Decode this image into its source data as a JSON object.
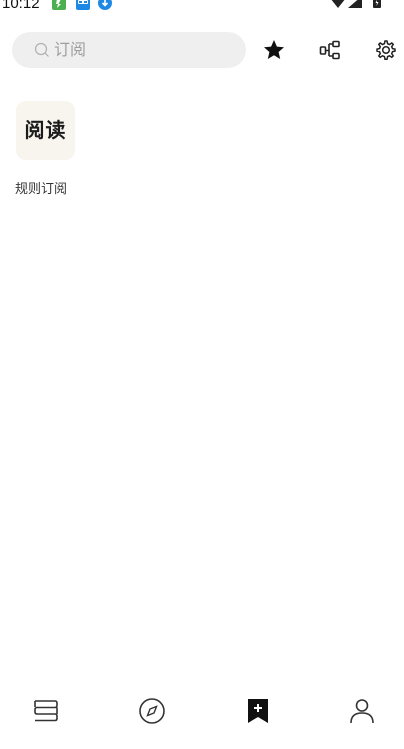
{
  "status_bar": {
    "time": "10:12"
  },
  "search": {
    "placeholder": "订阅"
  },
  "toolbar": {
    "favorites_icon": "star-icon",
    "group_icon": "group-icon",
    "settings_icon": "gear-icon"
  },
  "rule_sources": [
    {
      "tile_text": "阅读",
      "label": "规则订阅"
    }
  ],
  "bottom_nav": {
    "items": [
      {
        "icon": "bookshelf-icon",
        "active": false
      },
      {
        "icon": "compass-icon",
        "active": false
      },
      {
        "icon": "bookmark-add-icon",
        "active": true
      },
      {
        "icon": "person-icon",
        "active": false
      }
    ]
  },
  "colors": {
    "background": "#ffffff",
    "search_background": "#efefef",
    "placeholder": "#9e9e9e",
    "tile_background": "#f7f5ee",
    "icon": "#333333",
    "active_icon": "#111111"
  }
}
